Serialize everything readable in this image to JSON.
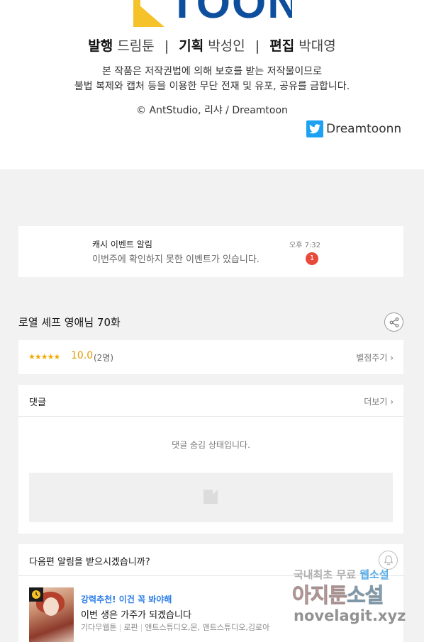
{
  "credits": {
    "logo_text": "TOON",
    "staff": [
      {
        "role": "발행",
        "name": "드림툰"
      },
      {
        "role": "기획",
        "name": "박성인"
      },
      {
        "role": "편집",
        "name": "박대영"
      }
    ],
    "separator": "|",
    "notice_line1": "본 작품은 저작권법에 의해 보호를 받는 저작물이므로",
    "notice_line2": "불법 복제와 캡처 등을 이용한 무단 전재 및 유포, 공유를 금합니다.",
    "copyright": "© AntStudio, 리샤 / Dreamtoon",
    "twitter_handle": "Dreamtoonn"
  },
  "push_notice": {
    "title": "캐시 이벤트 알림",
    "message": "이번주에 확인하지 못한 이벤트가 있습니다.",
    "time": "오후 7:32",
    "badge_count": "1"
  },
  "episode": {
    "title": "로열 셰프 영애님 70화"
  },
  "rating": {
    "stars": "★★★★★",
    "score": "10.0",
    "votes": "(2명)",
    "rate_label": "별점주기 ›"
  },
  "comments": {
    "title": "댓글",
    "more_label": "더보기 ›",
    "hidden_message": "댓글 숨김 상태입니다."
  },
  "next_alert": {
    "question": "다음편 알림을 받으시겠습니까?",
    "rec_label": "강력추천! 이건 꼭 봐야해",
    "rec_title": "이번 생은 가주가 되겠습니다",
    "rec_meta": [
      "기다무웹툰",
      "로판",
      "앤트스튜디오,몬, 앤트스튜디오,김로아"
    ]
  },
  "watermark": {
    "top_plain": "국내최초 무료 ",
    "top_highlight": "웹소설",
    "mid_plain": "아지툰",
    "mid_highlight": "소설",
    "bottom": "novelagit.xyz"
  },
  "colors": {
    "brand_blue": "#0d4f9d",
    "brand_yellow": "#f6c22a",
    "twitter": "#1da1f2",
    "badge_red": "#e8493a",
    "star": "#f2a900",
    "recommend_blue": "#2b7de9"
  }
}
